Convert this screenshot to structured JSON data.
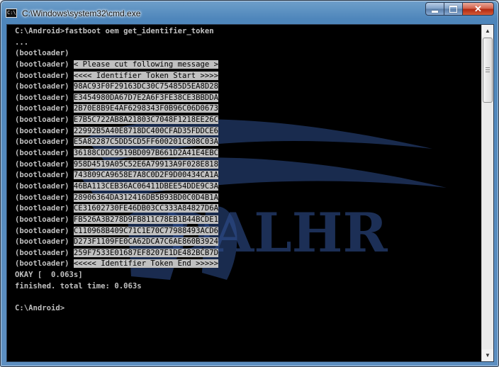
{
  "window": {
    "title": "C:\\Windows\\system32\\cmd.exe",
    "app_icon_text": "C:\\",
    "icon": "cmd-icon",
    "controls": {
      "minimize_icon": "minimize-icon",
      "maximize_icon": "maximize-icon",
      "close_icon": "close-icon",
      "close_glyph": "✕"
    }
  },
  "watermark": {
    "text": "DALHR"
  },
  "console": {
    "lines": [
      {
        "prefix": "C:\\Android>fastboot oem get_identifier_token",
        "selected": ""
      },
      {
        "prefix": "...",
        "selected": ""
      },
      {
        "prefix": "(bootloader) ",
        "selected": ""
      },
      {
        "prefix": "(bootloader) ",
        "selected": "< Please cut following message >"
      },
      {
        "prefix": "(bootloader) ",
        "selected": "<<<< Identifier Token Start >>>>"
      },
      {
        "prefix": "(bootloader) ",
        "selected": "98AC93F0F29163DC30C75485D5EA8D28"
      },
      {
        "prefix": "(bootloader) ",
        "selected": "E3454980DA67D7E2A6F3FE38CE3BBDDA"
      },
      {
        "prefix": "(bootloader) ",
        "selected": "2B70E8B9E4AF6298343F0B96C06D0673"
      },
      {
        "prefix": "(bootloader) ",
        "selected": "E7B5C722AB8A21803C7048F1218EE26C"
      },
      {
        "prefix": "(bootloader) ",
        "selected": "22992B5A40E8718DC400CFAD35FDDCE6"
      },
      {
        "prefix": "(bootloader) ",
        "selected": "E5A82287C5DD5CD5FF600201C808C03A"
      },
      {
        "prefix": "(bootloader) ",
        "selected": "36188CDDC9519BD097B661D2A41E4EBC"
      },
      {
        "prefix": "(bootloader) ",
        "selected": "958D4519A05C52E6A79913A9F028E818"
      },
      {
        "prefix": "(bootloader) ",
        "selected": "743809CA9658E7A8C0D2F9D00434CA1A"
      },
      {
        "prefix": "(bootloader) ",
        "selected": "46BA113CEB36AC06411DBEE54DDE9C3A"
      },
      {
        "prefix": "(bootloader) ",
        "selected": "28906364DA312416DB5B93BD0C0D4B1A"
      },
      {
        "prefix": "(bootloader) ",
        "selected": "CE31602730FE46DB03CC333A84827D6A"
      },
      {
        "prefix": "(bootloader) ",
        "selected": "FB526A3B278D9FB811C78EB1B44BCDE1"
      },
      {
        "prefix": "(bootloader) ",
        "selected": "C110968B409C71C1E70C77988493ACD6"
      },
      {
        "prefix": "(bootloader) ",
        "selected": "D273F1109FE0CA62DCA7C6AE860B3924"
      },
      {
        "prefix": "(bootloader) ",
        "selected": "259F7533E01687EF8207E1DE482BCB7D"
      },
      {
        "prefix": "(bootloader) ",
        "selected": "<<<<< Identifier Token End >>>>>"
      },
      {
        "prefix": "OKAY [  0.063s]",
        "selected": ""
      },
      {
        "prefix": "finished. total time: 0.063s",
        "selected": ""
      },
      {
        "prefix": "",
        "selected": ""
      },
      {
        "prefix": "C:\\Android>",
        "selected": ""
      }
    ]
  },
  "scrollbar": {
    "up_icon": "scroll-up-arrow-icon",
    "down_icon": "scroll-down-arrow-icon",
    "up_glyph": "▲",
    "down_glyph": "▼"
  },
  "colors": {
    "console_bg": "#000000",
    "console_text": "#c0c0c0",
    "selection_bg": "#c0c0c0",
    "selection_text": "#000000",
    "watermark": "#2f4f8f"
  }
}
